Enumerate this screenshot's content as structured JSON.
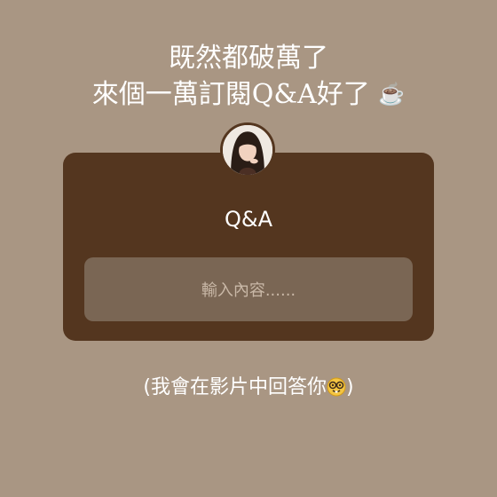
{
  "header": {
    "line1": "既然都破萬了",
    "line2": "來個一萬訂閱Q&A好了",
    "cup_icon": "☕",
    "cup_icon_name": "hot-beverage-icon"
  },
  "qa_card": {
    "title": "Q&A",
    "avatar_icon": "profile-avatar",
    "input_placeholder": "輸入內容......"
  },
  "footer": {
    "text": "(我會在影片中回答你",
    "close_paren": ")",
    "emoji_name": "nerd-face-icon"
  },
  "colors": {
    "background": "#a99683",
    "card": "#54361f",
    "input": "#7a6654",
    "placeholder": "#c9b8a7",
    "text": "#ffffff"
  }
}
